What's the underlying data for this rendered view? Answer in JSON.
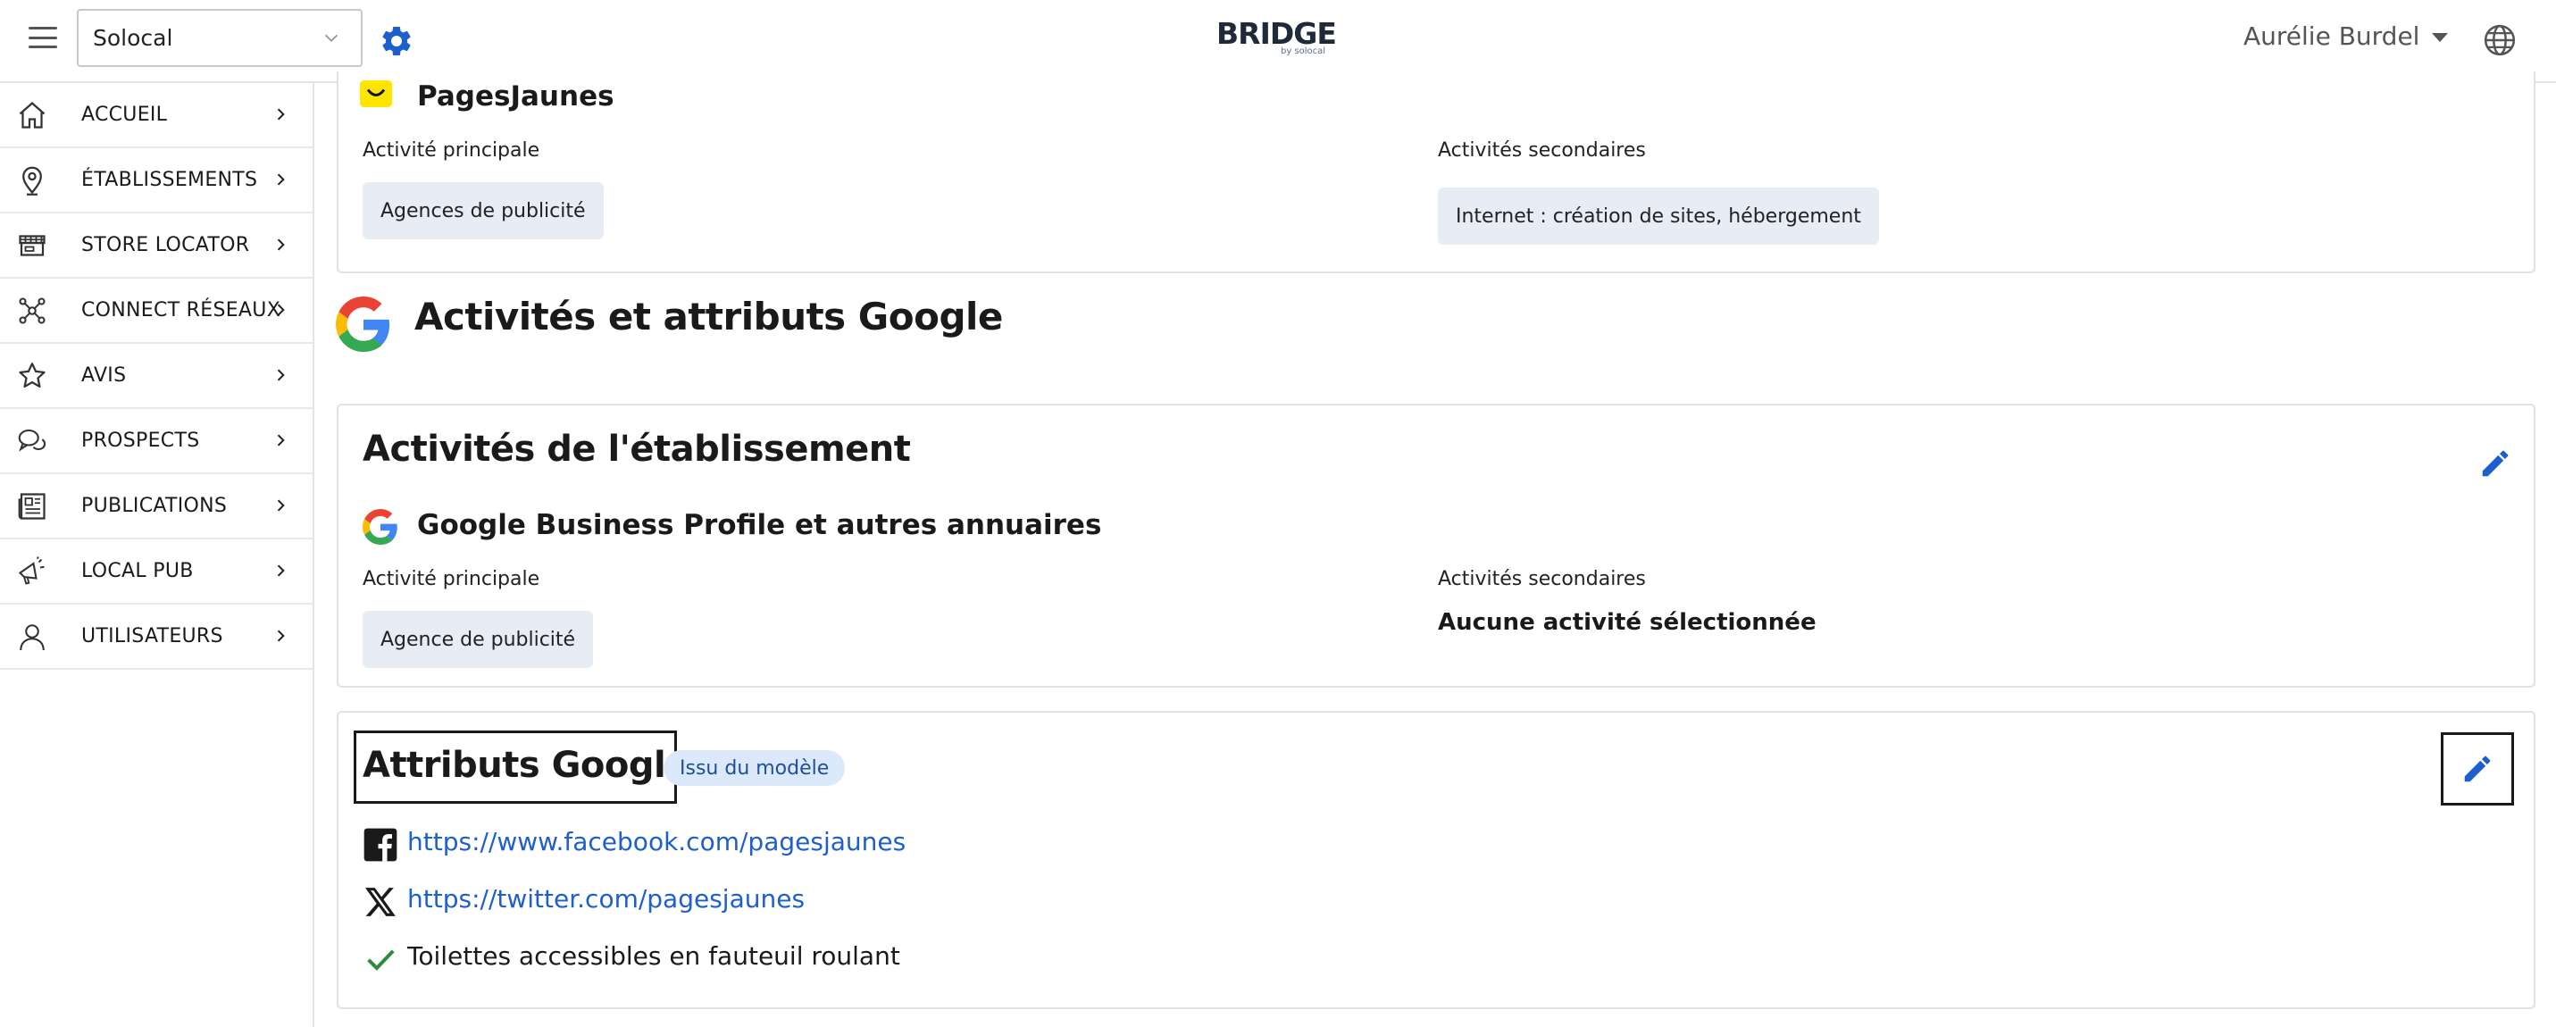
{
  "header": {
    "org_select_value": "Solocal",
    "logo_text": "BRIDGE",
    "logo_sub": "by solocal",
    "user_name": "Aurélie Burdel"
  },
  "sidebar": {
    "items": [
      {
        "label": "ACCUEIL",
        "icon": "home-icon"
      },
      {
        "label": "ÉTABLISSEMENTS",
        "icon": "location-pin-icon"
      },
      {
        "label": "STORE LOCATOR",
        "icon": "store-icon"
      },
      {
        "label": "CONNECT RÉSEAUX",
        "icon": "network-icon"
      },
      {
        "label": "AVIS",
        "icon": "star-icon"
      },
      {
        "label": "PROSPECTS",
        "icon": "chat-bubbles-icon"
      },
      {
        "label": "PUBLICATIONS",
        "icon": "newspaper-icon"
      },
      {
        "label": "LOCAL PUB",
        "icon": "megaphone-icon"
      },
      {
        "label": "UTILISATEURS",
        "icon": "user-icon"
      }
    ]
  },
  "pagesjaunes_card": {
    "source_title": "PagesJaunes",
    "main_label": "Activité principale",
    "main_value": "Agences de publicité",
    "secondary_label": "Activités secondaires",
    "secondary_value": "Internet : création de sites, hébergement"
  },
  "google_section": {
    "title": "Activités et attributs Google"
  },
  "activities_card": {
    "title": "Activités de l'établissement",
    "source_title": "Google Business Profile et autres annuaires",
    "main_label": "Activité principale",
    "main_value": "Agence de publicité",
    "secondary_label": "Activités secondaires",
    "secondary_value": "Aucune activité sélectionnée"
  },
  "attributes_card": {
    "title": "Attributs Google",
    "badge": "Issu du modèle",
    "facebook_url": "https://www.facebook.com/pagesjaunes",
    "twitter_url": "https://twitter.com/pagesjaunes",
    "accessibility": "Toilettes accessibles en fauteuil roulant"
  },
  "colors": {
    "accent": "#1e5fce",
    "chip_bg": "#e7ecf5",
    "badge_bg": "#dbe9fb",
    "check_green": "#2e8b3d"
  }
}
